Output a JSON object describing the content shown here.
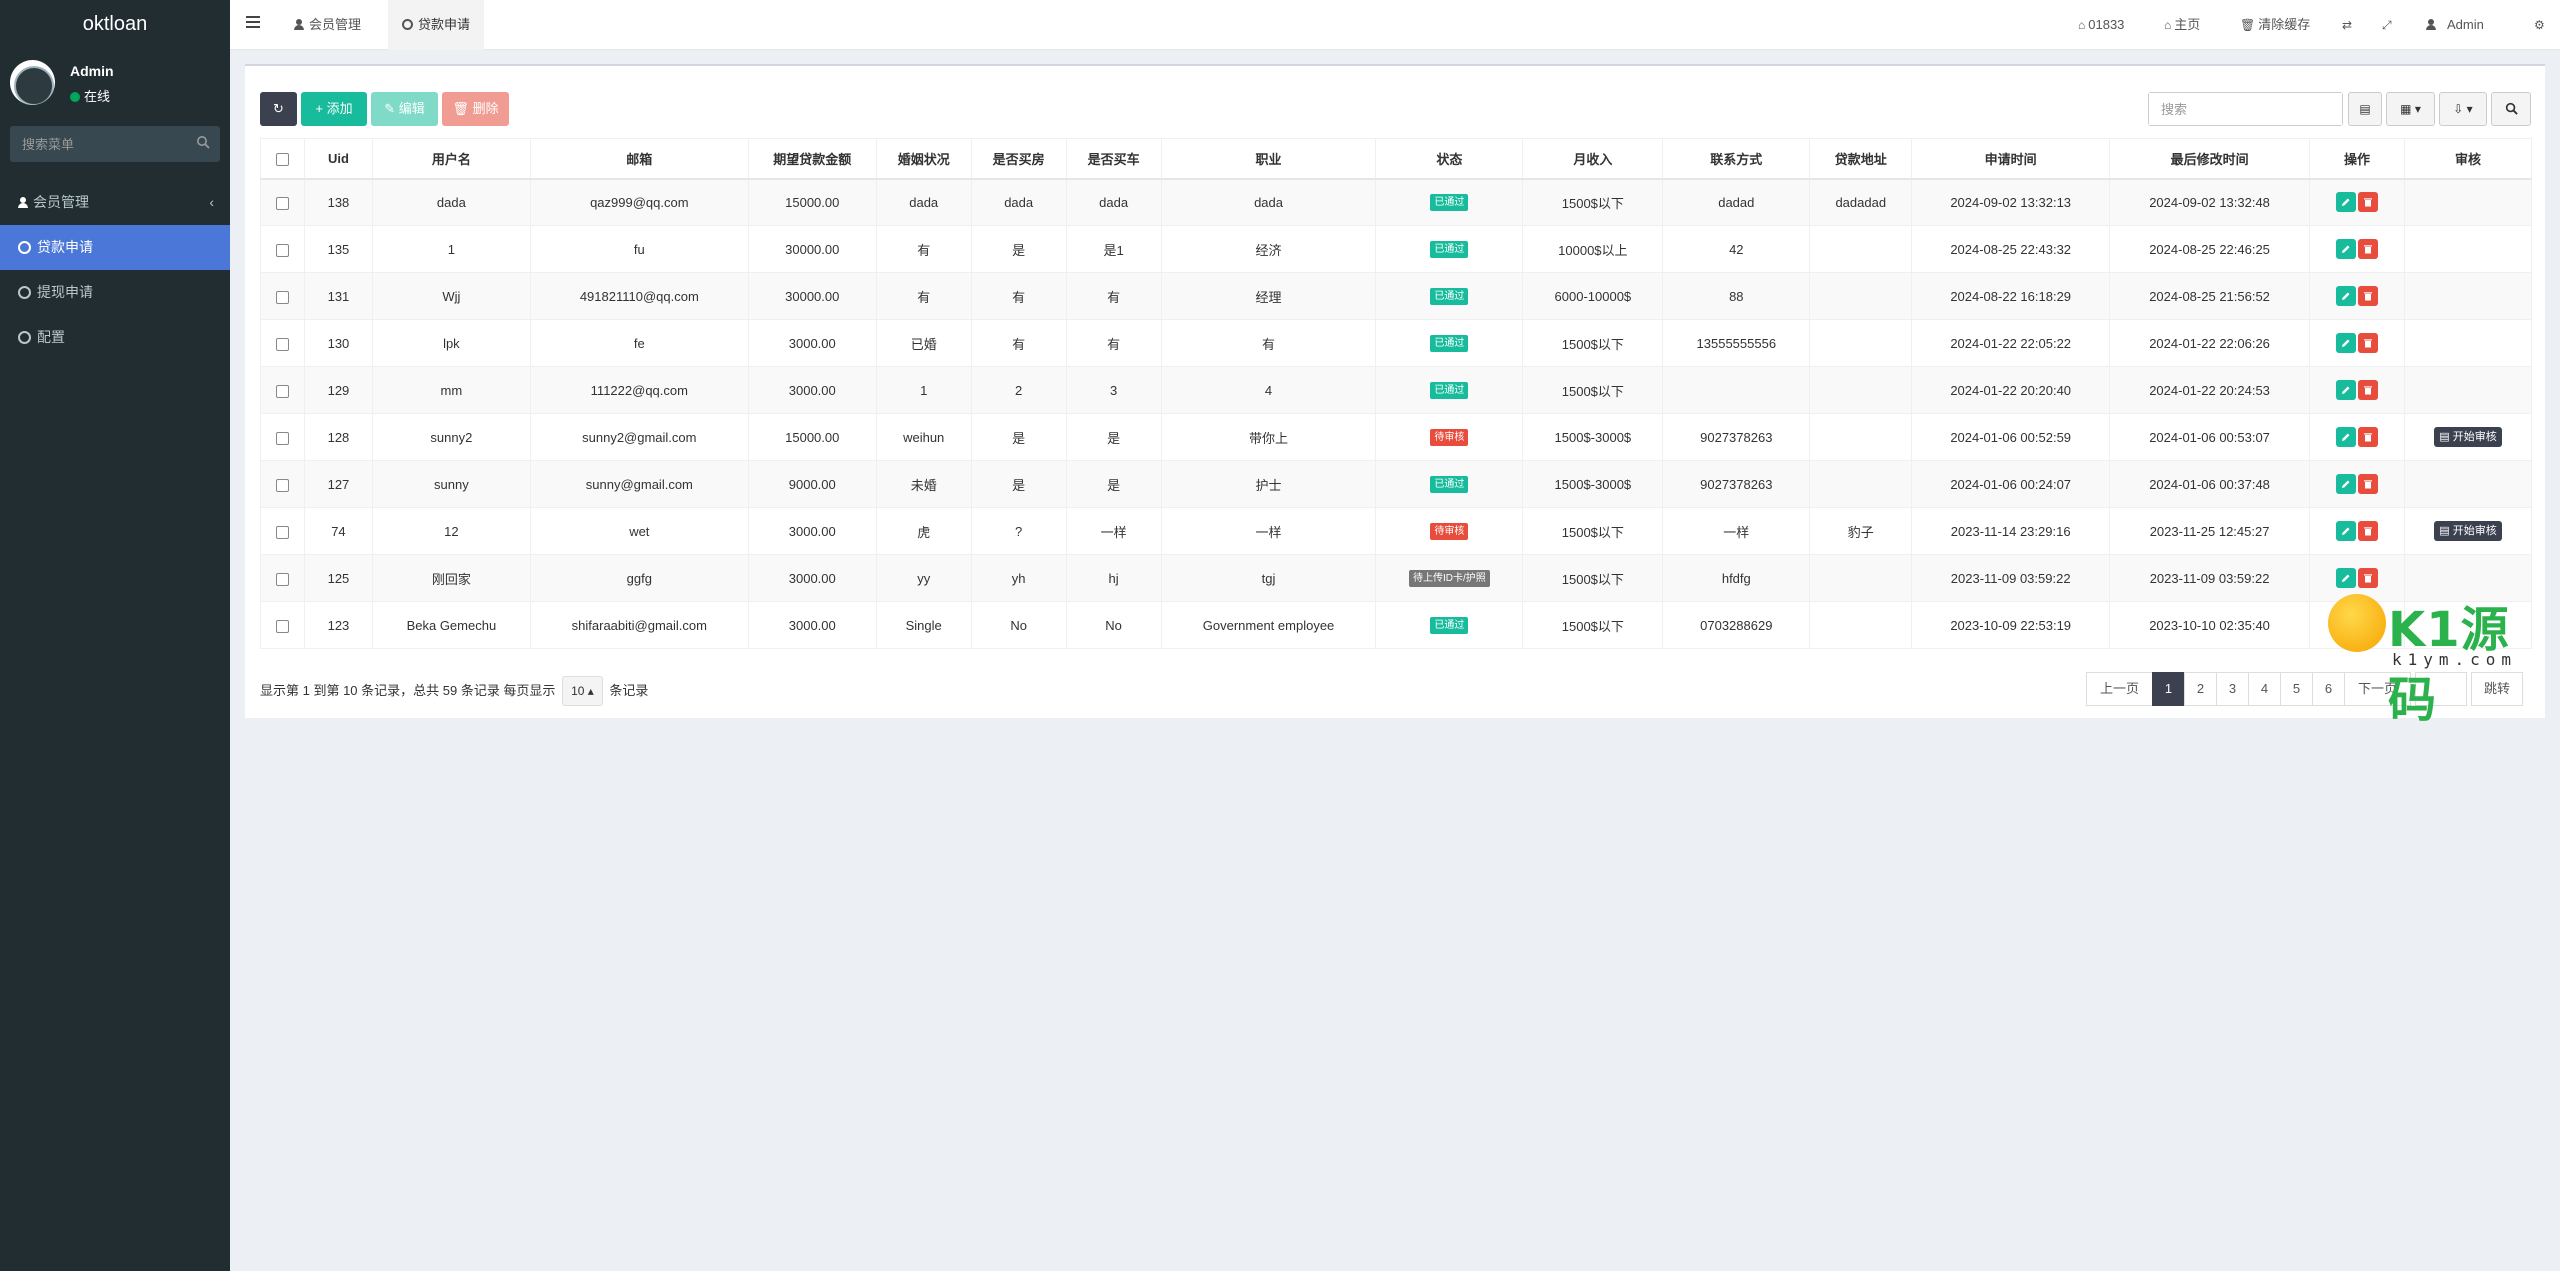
{
  "sidebar": {
    "logo": "oktloan",
    "user": {
      "name": "Admin",
      "status": "在线"
    },
    "search_placeholder": "搜索菜单",
    "items": [
      {
        "label": "会员管理",
        "active": false
      },
      {
        "label": "贷款申请",
        "active": true
      },
      {
        "label": "提现申请",
        "active": false
      },
      {
        "label": "配置",
        "active": false
      }
    ]
  },
  "header": {
    "tabs": [
      {
        "label": "会员管理"
      },
      {
        "label": "贷款申请"
      }
    ],
    "right": {
      "code": "01833",
      "home": "主页",
      "clear_cache": "清除缓存",
      "admin": "Admin"
    }
  },
  "toolbar": {
    "add": "添加",
    "edit": "编辑",
    "delete": "删除",
    "search_placeholder": "搜索"
  },
  "table": {
    "columns": [
      "Uid",
      "用户名",
      "邮箱",
      "期望贷款金额",
      "婚姻状况",
      "是否买房",
      "是否买车",
      "职业",
      "状态",
      "月收入",
      "联系方式",
      "贷款地址",
      "申请时间",
      "最后修改时间",
      "操作",
      "审核"
    ],
    "rows": [
      {
        "uid": "138",
        "username": "dada",
        "email": "qaz999@qq.com",
        "amount": "15000.00",
        "marital": "dada",
        "house": "dada",
        "car": "dada",
        "job": "dada",
        "status": "已通过",
        "status_type": "green",
        "income": "1500$以下",
        "contact": "dadad",
        "address": "dadadad",
        "applied": "2024-09-02 13:32:13",
        "modified": "2024-09-02 13:32:48",
        "audit": ""
      },
      {
        "uid": "135",
        "username": "1",
        "email": "fu",
        "amount": "30000.00",
        "marital": "有",
        "house": "是",
        "car": "是1",
        "job": "经济",
        "status": "已通过",
        "status_type": "green",
        "income": "10000$以上",
        "contact": "42",
        "address": "",
        "applied": "2024-08-25 22:43:32",
        "modified": "2024-08-25 22:46:25",
        "audit": ""
      },
      {
        "uid": "131",
        "username": "Wjj",
        "email": "491821110@qq.com",
        "amount": "30000.00",
        "marital": "有",
        "house": "有",
        "car": "有",
        "job": "经理",
        "status": "已通过",
        "status_type": "green",
        "income": "6000-10000$",
        "contact": "88",
        "address": "",
        "applied": "2024-08-22 16:18:29",
        "modified": "2024-08-25 21:56:52",
        "audit": ""
      },
      {
        "uid": "130",
        "username": "lpk",
        "email": "fe",
        "amount": "3000.00",
        "marital": "已婚",
        "house": "有",
        "car": "有",
        "job": "有",
        "status": "已通过",
        "status_type": "green",
        "income": "1500$以下",
        "contact": "13555555556",
        "address": "",
        "applied": "2024-01-22 22:05:22",
        "modified": "2024-01-22 22:06:26",
        "audit": ""
      },
      {
        "uid": "129",
        "username": "mm",
        "email": "111222@qq.com",
        "amount": "3000.00",
        "marital": "1",
        "house": "2",
        "car": "3",
        "job": "4",
        "status": "已通过",
        "status_type": "green",
        "income": "1500$以下",
        "contact": "",
        "address": "",
        "applied": "2024-01-22 20:20:40",
        "modified": "2024-01-22 20:24:53",
        "audit": ""
      },
      {
        "uid": "128",
        "username": "sunny2",
        "email": "sunny2@gmail.com",
        "amount": "15000.00",
        "marital": "weihun",
        "house": "是",
        "car": "是",
        "job": "带你上",
        "status": "待审核",
        "status_type": "red",
        "income": "1500$-3000$",
        "contact": "9027378263",
        "address": "",
        "applied": "2024-01-06 00:52:59",
        "modified": "2024-01-06 00:53:07",
        "audit": "开始审核"
      },
      {
        "uid": "127",
        "username": "sunny",
        "email": "sunny@gmail.com",
        "amount": "9000.00",
        "marital": "未婚",
        "house": "是",
        "car": "是",
        "job": "护士",
        "status": "已通过",
        "status_type": "green",
        "income": "1500$-3000$",
        "contact": "9027378263",
        "address": "",
        "applied": "2024-01-06 00:24:07",
        "modified": "2024-01-06 00:37:48",
        "audit": ""
      },
      {
        "uid": "74",
        "username": "12",
        "email": "wet",
        "amount": "3000.00",
        "marital": "虎",
        "house": "?",
        "car": "一样",
        "job": "一样",
        "status": "待审核",
        "status_type": "red",
        "income": "1500$以下",
        "contact": "一样",
        "address": "豹子",
        "applied": "2023-11-14 23:29:16",
        "modified": "2023-11-25 12:45:27",
        "audit": "开始审核"
      },
      {
        "uid": "125",
        "username": "刚回家",
        "email": "ggfg",
        "amount": "3000.00",
        "marital": "yy",
        "house": "yh",
        "car": "hj",
        "job": "tgj",
        "status": "待上传ID卡/护照",
        "status_type": "gray",
        "income": "1500$以下",
        "contact": "hfdfg",
        "address": "",
        "applied": "2023-11-09 03:59:22",
        "modified": "2023-11-09 03:59:22",
        "audit": ""
      },
      {
        "uid": "123",
        "username": "Beka Gemechu",
        "email": "shifaraabiti@gmail.com",
        "amount": "3000.00",
        "marital": "Single",
        "house": "No",
        "car": "No",
        "job": "Government employee",
        "status": "已通过",
        "status_type": "green",
        "income": "1500$以下",
        "contact": "0703288629",
        "address": "",
        "applied": "2023-10-09 22:53:19",
        "modified": "2023-10-10 02:35:40",
        "audit": ""
      }
    ]
  },
  "footer": {
    "info_prefix": "显示第 1 到第 10 条记录，总共 59 条记录 每页显示",
    "page_size": "10",
    "info_suffix": "条记录",
    "pager": {
      "prev": "上一页",
      "pages": [
        "1",
        "2",
        "3",
        "4",
        "5",
        "6"
      ],
      "current": "1",
      "next": "下一页",
      "jump": "跳转"
    }
  },
  "watermark": {
    "main": "K1源码",
    "sub": "k1ym.com"
  },
  "colors": {
    "sidebar_bg": "#222d32",
    "active_menu": "#4b77d8",
    "success": "#18bc9c",
    "danger": "#e74c3c",
    "dark_button": "#3c4150"
  }
}
